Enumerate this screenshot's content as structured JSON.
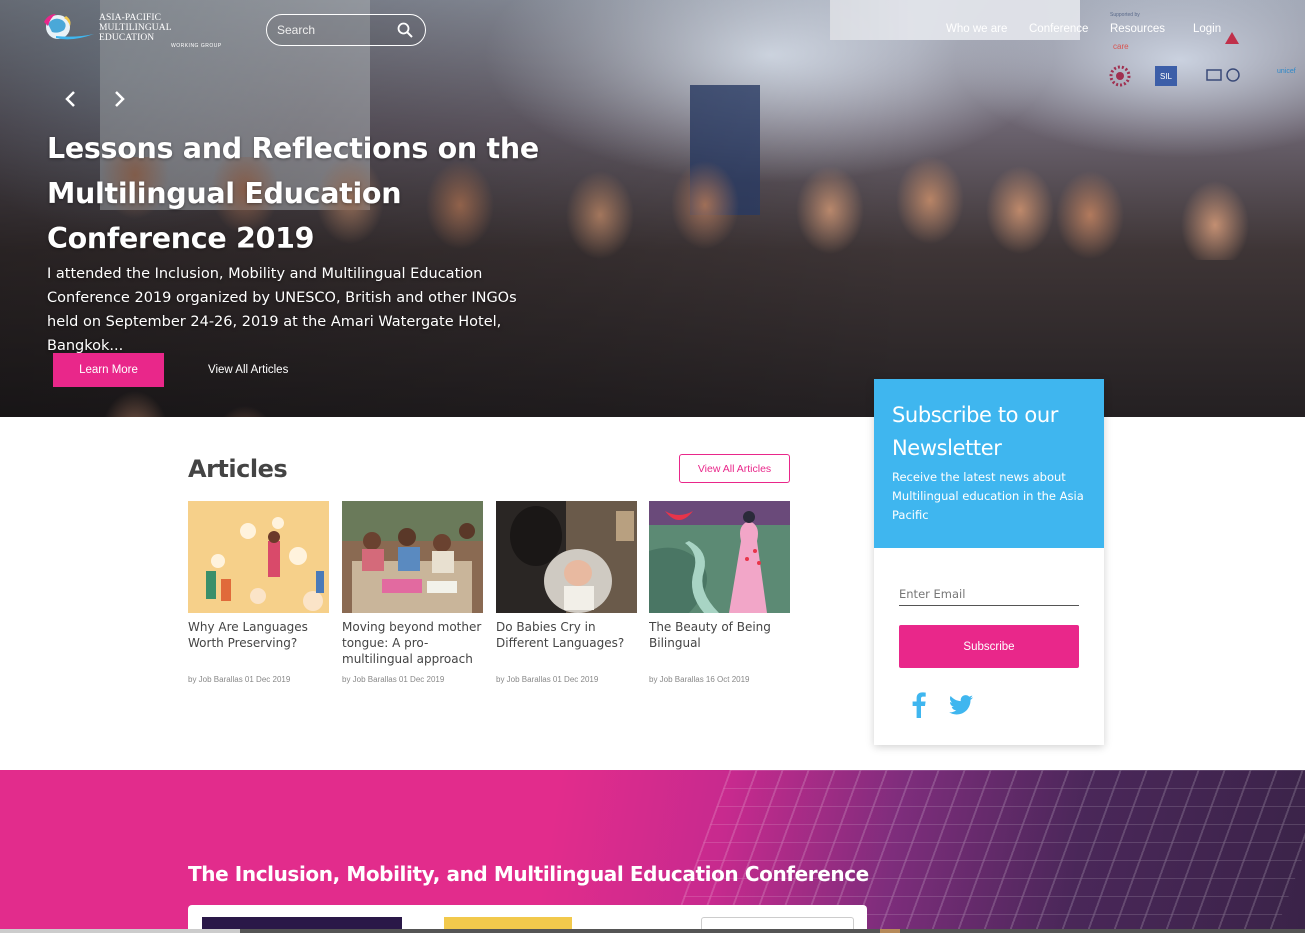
{
  "header": {
    "logo": {
      "line1": "ASIA-PACIFIC",
      "line2": "MULTILINGUAL EDUCATION",
      "line3": "WORKING GROUP"
    },
    "search": {
      "placeholder": "Search"
    },
    "nav": [
      {
        "label": "Who we are"
      },
      {
        "label": "Conference"
      },
      {
        "label": "Resources"
      },
      {
        "label": "Login"
      }
    ],
    "sponsors": {
      "caption": "Supported by",
      "care": "care",
      "sil": "SIL",
      "unicef": "unicef"
    }
  },
  "hero": {
    "title": "Lessons and Reflections on the Multilingual Education Conference 2019",
    "text": "I attended the Inclusion, Mobility and Multilingual Education Conference 2019 organized by UNESCO, British and other INGOs held on September 24-26, 2019 at the Amari Watergate Hotel, Bangkok...",
    "learn_more": "Learn More",
    "view_all": "View All Articles"
  },
  "articles": {
    "title": "Articles",
    "view_all": "View All Articles",
    "items": [
      {
        "title": "Why Are Languages Worth Preserving?",
        "meta": "by Job Barallas 01 Dec 2019"
      },
      {
        "title": "Moving beyond mother tongue: A pro-multilingual approach ...",
        "meta": "by Job Barallas 01 Dec 2019"
      },
      {
        "title": "Do Babies Cry in Different Languages?",
        "meta": "by Job Barallas 01 Dec 2019"
      },
      {
        "title": "The Beauty of Being Bilingual",
        "meta": "by Job Barallas 16 Oct 2019"
      }
    ]
  },
  "newsletter": {
    "title": "Subscribe to our Newsletter",
    "text": "Receive the latest news about Multilingual education in the Asia Pacific",
    "email_placeholder": "Enter Email",
    "subscribe": "Subscribe"
  },
  "conference": {
    "title": "The Inclusion, Mobility, and Multilingual Education Conference"
  },
  "colors": {
    "accent": "#e9278a",
    "newsletter": "#3fb6ef"
  }
}
